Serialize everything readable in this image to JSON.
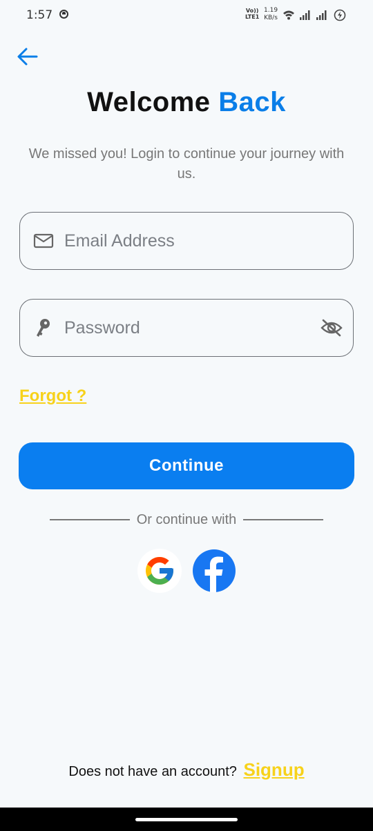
{
  "status_bar": {
    "time": "1:57",
    "volte_top": "Vo))",
    "volte_bottom": "LTE1",
    "speed_value": "1.19",
    "speed_unit": "KB/s"
  },
  "header": {
    "back_icon": "arrow-left-icon",
    "title_part1": "Welcome",
    "title_part2": "Back",
    "subtitle": "We missed you! Login to continue your journey with us."
  },
  "form": {
    "email": {
      "icon": "mail-icon",
      "placeholder": "Email Address",
      "value": ""
    },
    "password": {
      "icon": "key-icon",
      "placeholder": "Password",
      "value": "",
      "toggle_icon": "eye-off-icon"
    },
    "forgot_label": "Forgot ?",
    "continue_label": "Continue"
  },
  "social": {
    "divider_text": "Or continue with",
    "providers": [
      {
        "name": "google",
        "icon": "google-icon"
      },
      {
        "name": "facebook",
        "icon": "facebook-icon"
      }
    ]
  },
  "footer": {
    "prompt": "Does not have an account?",
    "signup_label": "Signup"
  },
  "colors": {
    "background": "#f6f9fb",
    "accent": "#0a7ef0",
    "link": "#f7d21b",
    "text_muted": "#777777",
    "title_dark": "#111111"
  }
}
